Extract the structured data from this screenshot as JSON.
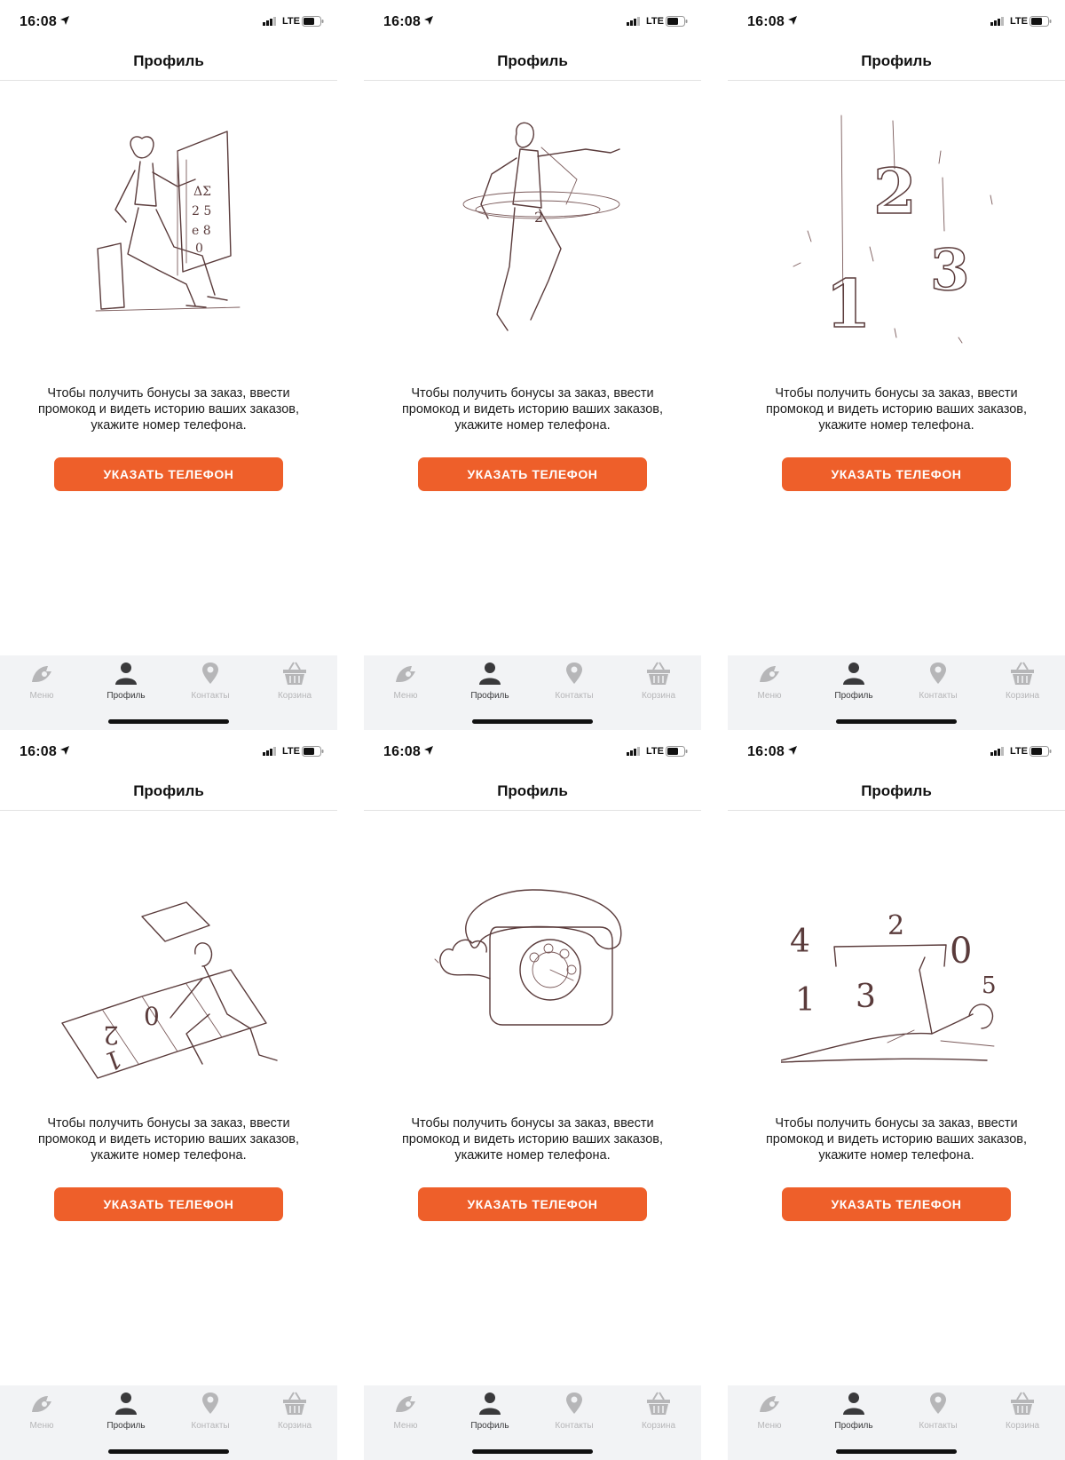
{
  "colors": {
    "accent": "#ee5f2a",
    "tab_inactive": "#b6b6b8",
    "tab_active": "#3a3a3c",
    "tabbar_bg": "#f2f3f5"
  },
  "status": {
    "time": "16:08",
    "network": "LTE"
  },
  "nav": {
    "title": "Профиль"
  },
  "message": "Чтобы получить бонусы за заказ, ввести промокод и видеть историю ваших заказов, укажите номер телефона.",
  "button_label": "УКАЗАТЬ ТЕЛЕФОН",
  "tabs": [
    {
      "label": "Меню",
      "icon": "menu-icon",
      "active": false
    },
    {
      "label": "Профиль",
      "icon": "profile-icon",
      "active": true
    },
    {
      "label": "Контакты",
      "icon": "location-pin-icon",
      "active": false
    },
    {
      "label": "Корзина",
      "icon": "basket-icon",
      "active": false
    }
  ],
  "screens": [
    {
      "illustration": "person-sitting-writing-numbers"
    },
    {
      "illustration": "person-dancing"
    },
    {
      "illustration": "floating-numbers-123",
      "digits": [
        "1",
        "2",
        "3"
      ]
    },
    {
      "illustration": "person-on-hopscotch",
      "digits": [
        "2",
        "0",
        "1"
      ]
    },
    {
      "illustration": "rotary-telephone"
    },
    {
      "illustration": "person-lying-with-numbers",
      "digits": [
        "4",
        "2",
        "0",
        "1",
        "3",
        "5"
      ]
    }
  ]
}
